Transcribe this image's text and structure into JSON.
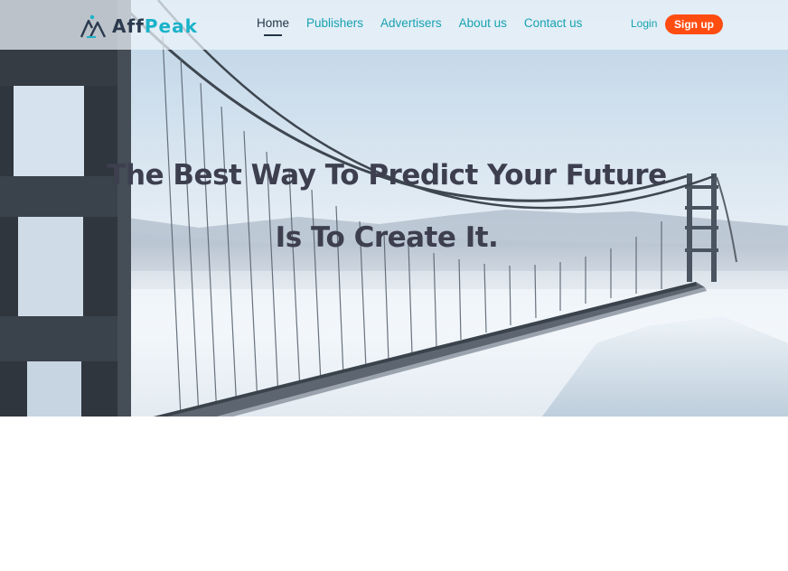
{
  "brand": {
    "name_part1": "Aff",
    "name_part2": "Peak",
    "colors": {
      "dark": "#2b3a4e",
      "accent": "#1ab3c9"
    }
  },
  "nav": {
    "items": [
      {
        "label": "Home",
        "active": true
      },
      {
        "label": "Publishers",
        "active": false
      },
      {
        "label": "Advertisers",
        "active": false
      },
      {
        "label": "About us",
        "active": false
      },
      {
        "label": "Contact us",
        "active": false
      }
    ],
    "login_label": "Login",
    "signup_label": "Sign up"
  },
  "hero": {
    "headline_line1": "The Best Way To Predict Your Future",
    "headline_line2": "Is To Create It.",
    "background": "golden-gate-bridge-in-fog-photo"
  },
  "colors": {
    "link": "#17a2b0",
    "nav_active": "#243447",
    "signup_bg": "#ff4d12",
    "headline": "#3d3f4f"
  }
}
